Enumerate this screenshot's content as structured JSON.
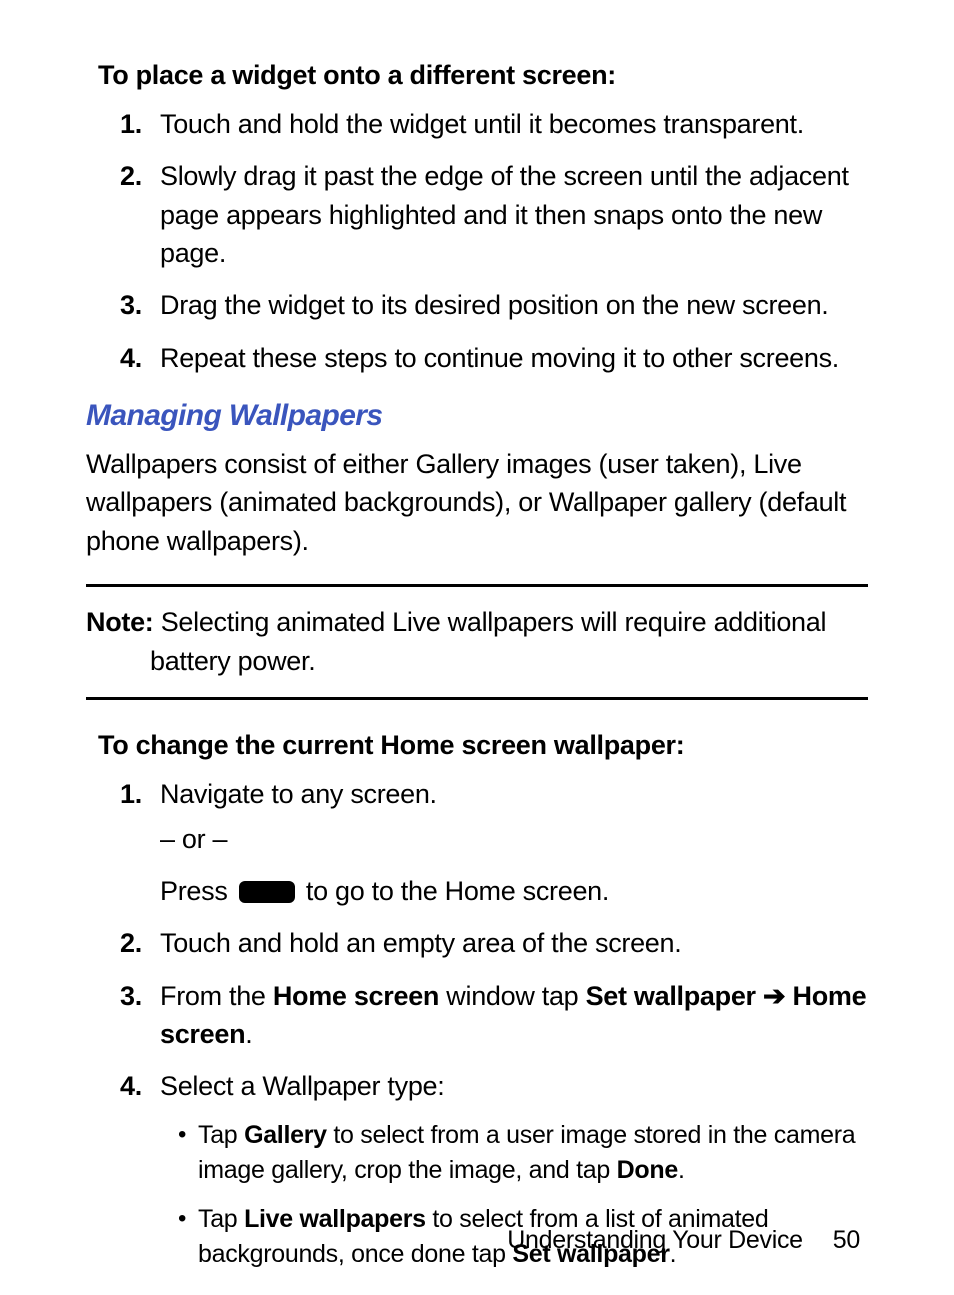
{
  "section1": {
    "heading": "To place a widget onto a different screen:",
    "steps": [
      "Touch and hold the widget until it becomes transparent.",
      "Slowly drag it past the edge of the screen until the adjacent page appears highlighted and it then snaps onto the new page.",
      "Drag the widget to its desired position on the new screen.",
      "Repeat these steps to continue moving it to other screens."
    ]
  },
  "section_heading": "Managing Wallpapers",
  "intro_para": "Wallpapers consist of either Gallery images (user taken), Live wallpapers (animated backgrounds), or Wallpaper gallery (default phone wallpapers).",
  "note": {
    "label": "Note:",
    "text": "Selecting animated Live wallpapers will require additional battery power."
  },
  "section2": {
    "heading": "To change the current Home screen wallpaper:",
    "step1": {
      "line1": "Navigate to any screen.",
      "or": "– or –",
      "press_lead": "Press ",
      "press_tail": " to go to the Home screen."
    },
    "step2": "Touch and hold an empty area of the screen.",
    "step3": {
      "lead": "From the ",
      "bold1": "Home screen",
      "mid": " window tap ",
      "bold2": "Set wallpaper",
      "arrow": " ➔ ",
      "bold3": "Home screen",
      "tail": "."
    },
    "step4": {
      "lead": "Select a Wallpaper type:",
      "bullets": [
        {
          "lead": "Tap ",
          "bold1": "Gallery",
          "mid": " to select from a user image stored in the camera image gallery, crop the image, and tap ",
          "bold2": "Done",
          "tail": "."
        },
        {
          "lead": "Tap ",
          "bold1": "Live wallpapers",
          "mid": " to select from a list of animated backgrounds, once done tap ",
          "bold2": "Set wallpaper",
          "tail": "."
        }
      ]
    }
  },
  "footer": {
    "chapter": "Understanding Your Device",
    "page": "50"
  }
}
